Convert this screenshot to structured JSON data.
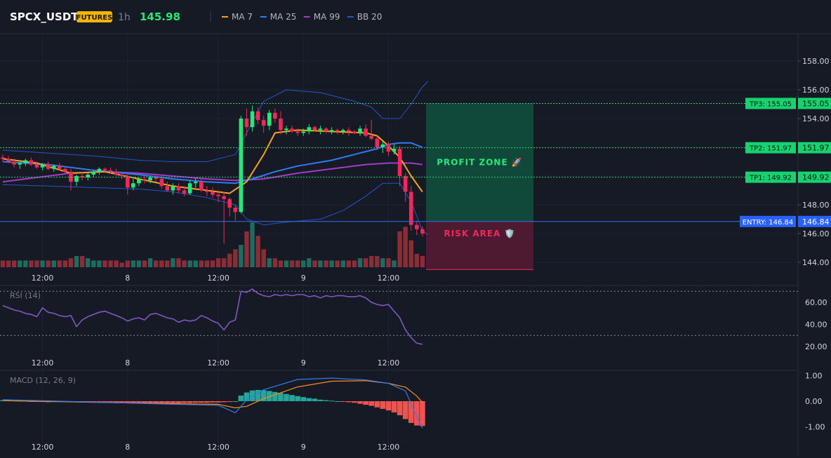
{
  "header": {
    "symbol": "SPCX_USDT",
    "badge": "FUTURES",
    "interval": "1h",
    "price": "145.98",
    "indicators": [
      {
        "label": "MA 7",
        "color": "#f7a21b"
      },
      {
        "label": "MA 25",
        "color": "#2f7bf5"
      },
      {
        "label": "MA 99",
        "color": "#a33bc4"
      },
      {
        "label": "BB 20",
        "color": "#2754c9"
      }
    ]
  },
  "colors": {
    "up": "#26e87a",
    "down": "#f2285a",
    "vol_up": "#1e6b60",
    "vol_down": "#8c2c36",
    "entry": "#2962ff",
    "tp": "#12c86b",
    "macd_pos": "#26a69a",
    "macd_neg": "#ef5350",
    "macd_line": "#2f7bf5",
    "signal_line": "#f78c1b",
    "rsi": "#7e57c2"
  },
  "time_axis": [
    "12:00",
    "8",
    "12:00",
    "9",
    "12:00"
  ],
  "levels": [
    {
      "tag": "TP3: 155.05",
      "price_label": "155.05",
      "value": 155.05,
      "kind": "tp"
    },
    {
      "tag": "TP2: 151.97",
      "price_label": "151.97",
      "value": 151.97,
      "kind": "tp"
    },
    {
      "tag": "TP1: 149.92",
      "price_label": "149.92",
      "value": 149.92,
      "kind": "tp"
    },
    {
      "tag": "ENTRY: 146.84",
      "price_label": "146.84",
      "value": 146.84,
      "kind": "entry"
    }
  ],
  "zones": {
    "profit": {
      "label": "PROFIT ZONE 🚀",
      "top": 155.05,
      "bottom": 146.84
    },
    "risk": {
      "label": "RISK AREA 🛡️",
      "top": 146.84,
      "bottom": 143.5
    }
  },
  "chart_data": [
    {
      "type": "candlestick",
      "pane": "price",
      "yaxis_ticks": [
        144.0,
        146.0,
        148.0,
        150.0,
        152.0,
        154.0,
        156.0,
        158.0
      ],
      "ylim": [
        143.5,
        159.3
      ],
      "candles": [
        [
          151.3,
          151.5,
          151.0,
          151.2
        ],
        [
          151.2,
          151.4,
          150.9,
          151.0
        ],
        [
          151.0,
          151.2,
          150.6,
          150.8
        ],
        [
          150.8,
          151.1,
          150.5,
          150.9
        ],
        [
          150.9,
          151.2,
          150.7,
          151.1
        ],
        [
          151.1,
          151.3,
          150.7,
          150.8
        ],
        [
          150.8,
          151.0,
          150.5,
          150.6
        ],
        [
          150.6,
          150.9,
          150.4,
          150.8
        ],
        [
          150.8,
          151.0,
          150.4,
          150.5
        ],
        [
          150.5,
          150.8,
          150.3,
          150.7
        ],
        [
          150.7,
          150.9,
          150.4,
          150.5
        ],
        [
          150.5,
          150.7,
          150.2,
          150.3
        ],
        [
          150.3,
          150.5,
          149.0,
          149.6
        ],
        [
          149.6,
          150.1,
          149.3,
          150.0
        ],
        [
          150.0,
          150.3,
          149.7,
          149.9
        ],
        [
          149.9,
          150.3,
          149.7,
          150.1
        ],
        [
          150.1,
          150.4,
          149.9,
          150.3
        ],
        [
          150.3,
          150.6,
          150.1,
          150.5
        ],
        [
          150.5,
          150.6,
          150.3,
          150.4
        ],
        [
          150.4,
          150.6,
          150.2,
          150.3
        ],
        [
          150.3,
          150.5,
          150.0,
          150.1
        ],
        [
          150.1,
          150.3,
          149.8,
          150.0
        ],
        [
          150.0,
          150.1,
          148.7,
          149.2
        ],
        [
          149.2,
          149.8,
          149.0,
          149.5
        ],
        [
          149.5,
          149.9,
          149.3,
          149.8
        ],
        [
          149.8,
          150.0,
          149.5,
          149.7
        ],
        [
          149.7,
          150.0,
          149.5,
          149.9
        ],
        [
          149.9,
          150.1,
          149.6,
          149.8
        ],
        [
          149.8,
          150.0,
          149.1,
          149.3
        ],
        [
          149.3,
          149.6,
          148.9,
          149.0
        ],
        [
          149.0,
          149.5,
          148.7,
          149.3
        ],
        [
          149.3,
          149.5,
          148.8,
          149.0
        ],
        [
          149.0,
          149.3,
          148.6,
          148.8
        ],
        [
          148.8,
          149.7,
          148.7,
          149.5
        ],
        [
          149.5,
          149.9,
          149.2,
          149.6
        ],
        [
          149.6,
          149.8,
          148.9,
          149.0
        ],
        [
          149.0,
          149.3,
          148.6,
          148.9
        ],
        [
          148.9,
          149.2,
          148.5,
          148.7
        ],
        [
          148.7,
          149.0,
          148.2,
          148.6
        ],
        [
          148.6,
          148.9,
          145.3,
          148.4
        ],
        [
          148.4,
          148.5,
          147.2,
          147.8
        ],
        [
          147.8,
          148.0,
          146.9,
          147.5
        ],
        [
          147.5,
          154.2,
          147.4,
          154.0
        ],
        [
          154.0,
          154.7,
          152.8,
          153.4
        ],
        [
          153.4,
          154.9,
          153.1,
          154.5
        ],
        [
          154.5,
          154.8,
          153.6,
          153.9
        ],
        [
          153.9,
          154.2,
          153.0,
          153.5
        ],
        [
          153.5,
          154.6,
          153.2,
          154.4
        ],
        [
          154.4,
          154.7,
          153.7,
          154.0
        ],
        [
          154.0,
          154.5,
          152.9,
          153.2
        ],
        [
          153.2,
          153.5,
          152.9,
          153.3
        ],
        [
          153.3,
          153.5,
          153.0,
          153.1
        ],
        [
          153.1,
          153.3,
          152.8,
          153.0
        ],
        [
          153.0,
          153.3,
          152.8,
          153.1
        ],
        [
          153.1,
          153.6,
          152.9,
          153.4
        ],
        [
          153.4,
          153.5,
          153.1,
          153.2
        ],
        [
          153.2,
          153.5,
          152.9,
          153.3
        ],
        [
          153.3,
          153.4,
          153.0,
          153.1
        ],
        [
          153.1,
          153.4,
          152.9,
          153.2
        ],
        [
          153.2,
          153.3,
          152.9,
          153.1
        ],
        [
          153.1,
          153.3,
          152.9,
          153.2
        ],
        [
          153.2,
          153.4,
          152.8,
          153.1
        ],
        [
          153.1,
          153.2,
          152.9,
          153.0
        ],
        [
          153.0,
          153.5,
          152.8,
          153.3
        ],
        [
          153.3,
          153.6,
          152.7,
          152.8
        ],
        [
          152.8,
          153.9,
          152.5,
          152.6
        ],
        [
          152.6,
          152.8,
          151.8,
          152.0
        ],
        [
          152.0,
          152.4,
          151.6,
          152.2
        ],
        [
          152.2,
          152.4,
          151.4,
          151.7
        ],
        [
          151.7,
          152.2,
          151.5,
          151.9
        ],
        [
          151.9,
          152.1,
          149.3,
          150.0
        ],
        [
          150.0,
          150.2,
          148.2,
          148.9
        ],
        [
          148.9,
          149.3,
          146.2,
          146.6
        ],
        [
          146.6,
          146.9,
          145.9,
          146.3
        ],
        [
          146.3,
          146.5,
          145.8,
          146.0
        ]
      ],
      "volume": [
        3,
        3,
        3,
        3,
        3,
        3,
        3,
        3,
        3,
        3,
        3,
        3,
        4,
        5,
        5,
        4,
        3,
        3,
        3,
        3,
        3,
        2,
        3,
        3,
        3,
        3,
        4,
        3,
        3,
        3,
        4,
        4,
        3,
        3,
        3,
        3,
        3,
        3,
        4,
        4,
        6,
        8,
        10,
        16,
        20,
        14,
        8,
        4,
        4,
        3,
        3,
        3,
        3,
        3,
        4,
        3,
        3,
        3,
        3,
        3,
        3,
        3,
        3,
        4,
        4,
        5,
        5,
        4,
        4,
        3,
        16,
        18,
        12,
        6,
        5
      ],
      "ma7": [
        [
          0,
          151.2
        ],
        [
          6,
          150.9
        ],
        [
          12,
          150.2
        ],
        [
          18,
          150.3
        ],
        [
          24,
          149.8
        ],
        [
          30,
          149.3
        ],
        [
          36,
          149.0
        ],
        [
          40,
          148.8
        ],
        [
          43,
          149.6
        ],
        [
          46,
          151.5
        ],
        [
          48,
          153.0
        ],
        [
          52,
          153.2
        ],
        [
          58,
          153.1
        ],
        [
          64,
          153.0
        ],
        [
          66,
          152.8
        ],
        [
          68,
          152.1
        ],
        [
          70,
          151.3
        ],
        [
          72,
          150.0
        ],
        [
          74,
          148.9
        ]
      ],
      "ma25": [
        [
          0,
          151.0
        ],
        [
          8,
          150.8
        ],
        [
          16,
          150.4
        ],
        [
          24,
          150.1
        ],
        [
          30,
          149.8
        ],
        [
          36,
          149.6
        ],
        [
          41,
          149.5
        ],
        [
          44,
          149.8
        ],
        [
          48,
          150.3
        ],
        [
          52,
          150.7
        ],
        [
          58,
          151.1
        ],
        [
          63,
          151.6
        ],
        [
          66,
          151.9
        ],
        [
          68,
          152.2
        ],
        [
          70,
          152.3
        ],
        [
          72,
          152.3
        ],
        [
          74,
          152.0
        ]
      ],
      "ma99": [
        [
          0,
          149.6
        ],
        [
          6,
          149.9
        ],
        [
          12,
          150.2
        ],
        [
          18,
          150.3
        ],
        [
          24,
          150.2
        ],
        [
          30,
          150.0
        ],
        [
          36,
          149.8
        ],
        [
          41,
          149.7
        ],
        [
          46,
          149.8
        ],
        [
          52,
          150.2
        ],
        [
          58,
          150.5
        ],
        [
          64,
          150.8
        ],
        [
          68,
          150.9
        ],
        [
          72,
          150.9
        ],
        [
          74,
          150.8
        ]
      ],
      "bb_upper": [
        [
          0,
          151.8
        ],
        [
          8,
          151.6
        ],
        [
          16,
          151.4
        ],
        [
          24,
          151.1
        ],
        [
          30,
          151.0
        ],
        [
          36,
          151.0
        ],
        [
          41,
          151.5
        ],
        [
          43,
          153.0
        ],
        [
          46,
          155.2
        ],
        [
          50,
          156.0
        ],
        [
          56,
          155.8
        ],
        [
          62,
          155.2
        ],
        [
          65,
          154.8
        ],
        [
          67,
          154.0
        ],
        [
          70,
          154.0
        ],
        [
          72,
          155.0
        ],
        [
          74,
          156.2
        ],
        [
          75,
          156.6
        ]
      ],
      "bb_lower": [
        [
          0,
          149.4
        ],
        [
          8,
          149.3
        ],
        [
          16,
          149.2
        ],
        [
          24,
          149.1
        ],
        [
          30,
          148.9
        ],
        [
          36,
          148.5
        ],
        [
          41,
          148.0
        ],
        [
          43,
          147.0
        ],
        [
          46,
          146.6
        ],
        [
          50,
          146.8
        ],
        [
          56,
          147.0
        ],
        [
          60,
          147.6
        ],
        [
          64,
          148.6
        ],
        [
          67,
          149.5
        ],
        [
          70,
          149.5
        ],
        [
          72,
          148.2
        ],
        [
          74,
          146.2
        ],
        [
          75,
          145.9
        ]
      ]
    },
    {
      "type": "line",
      "pane": "rsi",
      "title": "RSI (14)",
      "yaxis_ticks": [
        20.0,
        40.0,
        60.0
      ],
      "ylim": [
        12,
        74
      ],
      "bands": [
        30,
        70
      ],
      "values": [
        57,
        55,
        53,
        52,
        50,
        49,
        47,
        55,
        51,
        50,
        48,
        47,
        48,
        38,
        44,
        47,
        49,
        51,
        52,
        50,
        48,
        46,
        43,
        45,
        46,
        44,
        49,
        50,
        48,
        46,
        45,
        42,
        44,
        43,
        44,
        48,
        46,
        43,
        41,
        35,
        42,
        44,
        70,
        69,
        72,
        68,
        66,
        65,
        67,
        66,
        67,
        66,
        67,
        67,
        65,
        66,
        64,
        66,
        65,
        66,
        66,
        65,
        65,
        66,
        64,
        60,
        58,
        57,
        58,
        52,
        46,
        35,
        28,
        23,
        22
      ],
      "labels_after_x": [
        "12:00",
        "8",
        "12:00",
        "9",
        "12:00"
      ]
    },
    {
      "type": "bar",
      "pane": "macd",
      "title": "MACD (12, 26, 9)",
      "yaxis_ticks": [
        -1.0,
        0.0,
        1.0
      ],
      "ylim": [
        -1.3,
        1.2
      ],
      "histogram": [
        0.04,
        0.04,
        0.03,
        0.02,
        0.02,
        0.0,
        -0.02,
        -0.03,
        -0.04,
        -0.03,
        -0.03,
        -0.02,
        -0.03,
        -0.04,
        -0.05,
        -0.04,
        -0.03,
        -0.03,
        -0.04,
        -0.05,
        -0.06,
        -0.07,
        -0.08,
        -0.09,
        -0.09,
        -0.08,
        -0.08,
        -0.09,
        -0.1,
        -0.09,
        -0.08,
        -0.08,
        -0.07,
        -0.07,
        -0.06,
        -0.06,
        -0.06,
        -0.05,
        -0.05,
        -0.04,
        -0.03,
        0.0,
        0.22,
        0.34,
        0.42,
        0.44,
        0.43,
        0.4,
        0.36,
        0.32,
        0.28,
        0.24,
        0.2,
        0.16,
        0.12,
        0.1,
        0.06,
        0.04,
        0.02,
        0.0,
        -0.02,
        -0.04,
        -0.06,
        -0.1,
        -0.14,
        -0.18,
        -0.24,
        -0.3,
        -0.36,
        -0.44,
        -0.55,
        -0.7,
        -0.85,
        -0.95,
        -0.97
      ],
      "macd_line": [
        [
          0,
          0.06
        ],
        [
          10,
          0.0
        ],
        [
          20,
          -0.06
        ],
        [
          30,
          -0.12
        ],
        [
          38,
          -0.16
        ],
        [
          41,
          -0.45
        ],
        [
          43,
          0.05
        ],
        [
          46,
          0.45
        ],
        [
          52,
          0.85
        ],
        [
          58,
          0.9
        ],
        [
          64,
          0.83
        ],
        [
          68,
          0.7
        ],
        [
          71,
          0.4
        ],
        [
          73,
          -0.6
        ],
        [
          74,
          -1.05
        ]
      ],
      "signal_line": [
        [
          0,
          0.02
        ],
        [
          10,
          -0.02
        ],
        [
          20,
          -0.06
        ],
        [
          30,
          -0.1
        ],
        [
          38,
          -0.12
        ],
        [
          41,
          -0.26
        ],
        [
          43,
          -0.2
        ],
        [
          46,
          0.1
        ],
        [
          52,
          0.56
        ],
        [
          58,
          0.78
        ],
        [
          64,
          0.8
        ],
        [
          68,
          0.7
        ],
        [
          71,
          0.55
        ],
        [
          73,
          0.2
        ],
        [
          74,
          -0.05
        ]
      ]
    }
  ]
}
